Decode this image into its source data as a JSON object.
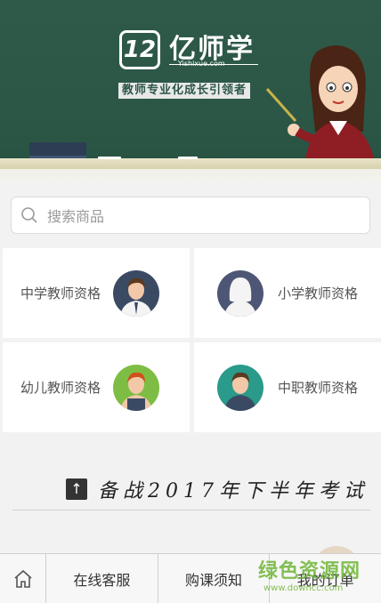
{
  "banner": {
    "logo_mark": "12",
    "brand_name": "亿师学",
    "brand_domain": "Yishixue.com",
    "slogan": "教师专业化成长引领者"
  },
  "search": {
    "placeholder": "搜索商品"
  },
  "categories": [
    {
      "label": "中学教师资格"
    },
    {
      "label": "小学教师资格"
    },
    {
      "label": "幼儿教师资格"
    },
    {
      "label": "中职教师资格"
    }
  ],
  "section": {
    "title": "备战2017年下半年考试"
  },
  "bottom_bar": {
    "home_icon": "home-icon",
    "tabs": [
      {
        "label": "在线客服"
      },
      {
        "label": "购课须知"
      },
      {
        "label": "我的订单"
      }
    ]
  },
  "watermark": {
    "text": "绿色资源网",
    "url": "www.downcc.com"
  },
  "colors": {
    "board_green": "#2b5646",
    "watermark_green": "#6fb536"
  }
}
